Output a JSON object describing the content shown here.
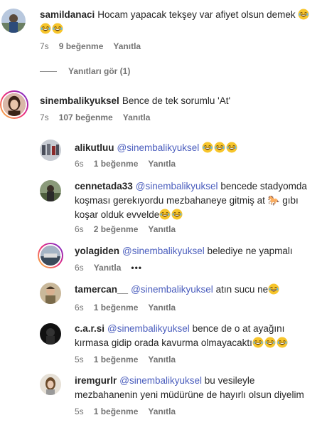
{
  "comments": [
    {
      "username": "samildanaci",
      "text": "Hocam yapacak tekşey var afiyet olsun demek",
      "emojis": [
        "😂",
        "😂",
        "😂"
      ],
      "time": "7s",
      "likes": "9 beğenme",
      "reply_label": "Yanıtla",
      "view_replies": "Yanıtları gör (1)"
    },
    {
      "username": "sinembalikyuksel",
      "text": "Bence de tek sorumlu 'At'",
      "time": "7s",
      "likes": "107 beğenme",
      "reply_label": "Yanıtla"
    }
  ],
  "replies": [
    {
      "username": "alikutluu",
      "mention": "@sinembalikyuksel",
      "text": "",
      "emojis": [
        "😂",
        "😂",
        "😂"
      ],
      "time": "6s",
      "likes": "1 beğenme",
      "reply_label": "Yanıtla"
    },
    {
      "username": "cennetada33",
      "mention": "@sinembalikyuksel",
      "text_line1": "bencede stadyomda",
      "text_line2": "koşması gerekıyordu mezbahaneye gitmiş at",
      "horse_emoji": "🐎",
      "text_line2b": "gıbı",
      "text_line3": "koşar olduk evvelde",
      "emojis": [
        "😂",
        "😂"
      ],
      "time": "6s",
      "likes": "2 beğenme",
      "reply_label": "Yanıtla"
    },
    {
      "username": "yolagiden",
      "mention": "@sinembalikyuksel",
      "text": "belediye ne yapmalı",
      "time": "6s",
      "reply_label": "Yanıtla",
      "more": "•••"
    },
    {
      "username": "tamercan__",
      "mention": "@sinembalikyuksel",
      "text": "atın sucu ne",
      "emojis": [
        "😂"
      ],
      "time": "6s",
      "likes": "1 beğenme",
      "reply_label": "Yanıtla"
    },
    {
      "username": "c.a.r.si",
      "mention": "@sinembalikyuksel",
      "text_line1": "bence de o at ayağını",
      "text_line2": "kırmasa gidip orada kavurma olmayacaktı",
      "emojis": [
        "😂",
        "😂",
        "😂"
      ],
      "time": "5s",
      "likes": "1 beğenme",
      "reply_label": "Yanıtla"
    },
    {
      "username": "iremgurlr",
      "mention": "@sinembalikyuksel",
      "text_line1": "bu vesileyle",
      "text_line2": "mezbahanenin yeni müdürüne de hayırlı olsun diyelim",
      "time": "5s",
      "likes": "1 beğenme",
      "reply_label": "Yanıtla"
    }
  ],
  "colors": {
    "text": "#262626",
    "secondary": "#737373",
    "mention": "#4a5dbd",
    "story_ring_start": "#f9ce34",
    "story_ring_end": "#6228d7"
  }
}
